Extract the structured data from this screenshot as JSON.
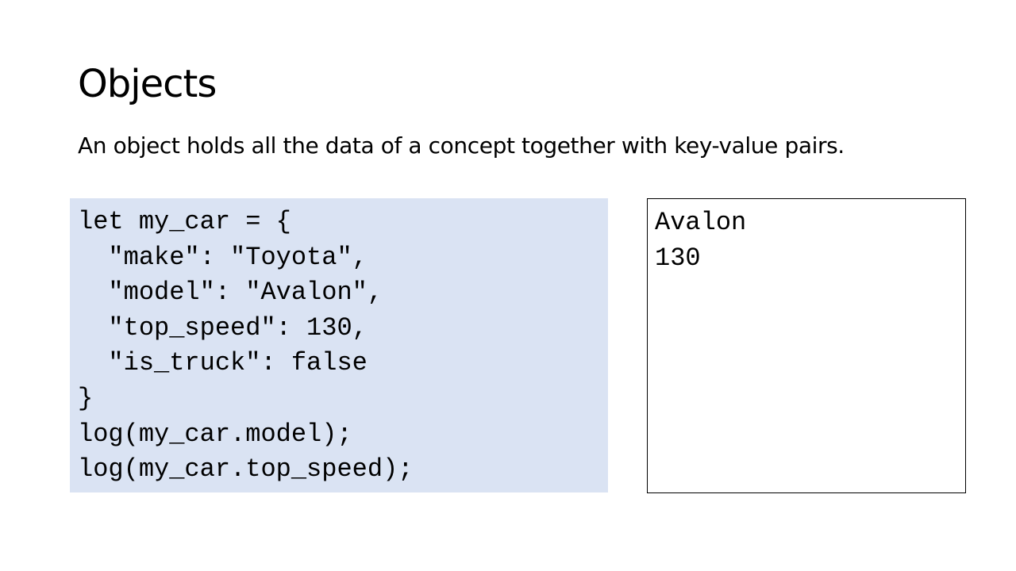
{
  "slide": {
    "title": "Objects",
    "subtitle": "An object holds all the data of a concept together with key-value pairs."
  },
  "code": {
    "lines": [
      "let my_car = {",
      "  \"make\": \"Toyota\",",
      "  \"model\": \"Avalon\",",
      "  \"top_speed\": 130,",
      "  \"is_truck\": false",
      "}",
      "log(my_car.model);",
      "log(my_car.top_speed);"
    ],
    "background_color": "#dae3f3"
  },
  "output": {
    "lines": [
      "Avalon",
      "130"
    ]
  }
}
